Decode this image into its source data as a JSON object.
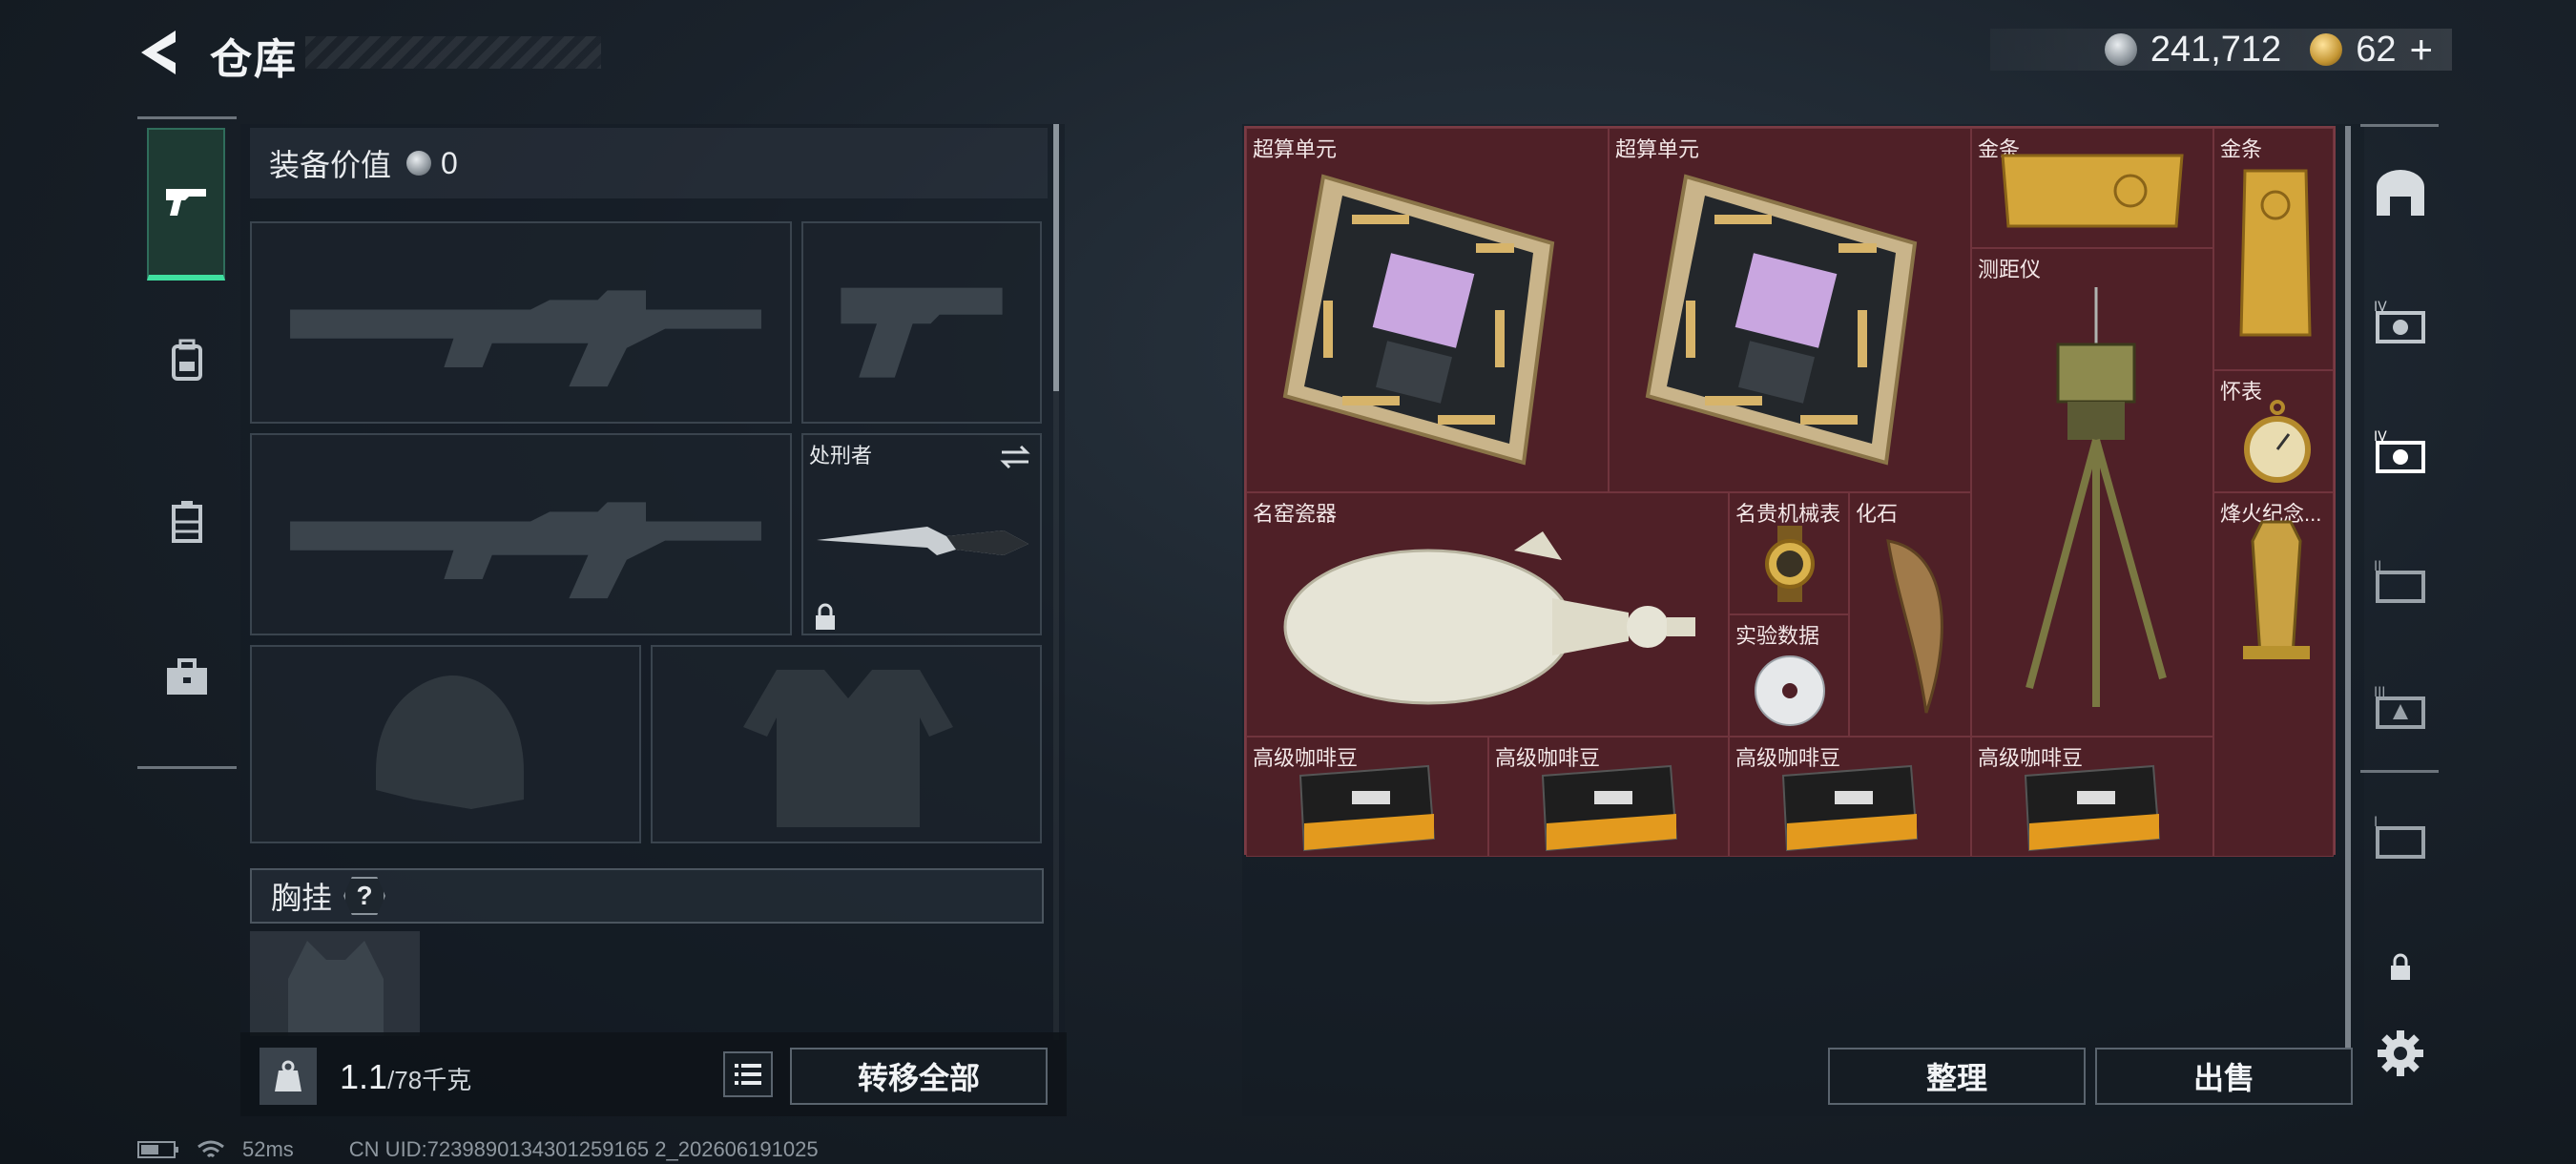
{
  "header": {
    "title": "仓库",
    "currency_silver": "241,712",
    "currency_gold": "62",
    "plus": "+"
  },
  "left_tabs": [
    {
      "name": "pistol",
      "active": true
    },
    {
      "name": "backpack"
    },
    {
      "name": "rig"
    },
    {
      "name": "case"
    }
  ],
  "equipment": {
    "value_label": "装备价值",
    "value": "0",
    "melee_label": "处刑者",
    "chest_rig_label": "胸挂",
    "chest_help": "?"
  },
  "bottom": {
    "weight_current": "1.1",
    "weight_max": "/78千克",
    "transfer_all": "转移全部",
    "sort": "整理",
    "sell": "出售"
  },
  "storage_items": [
    {
      "label": "超算单元",
      "icon": "supercomputer-board"
    },
    {
      "label": "超算单元",
      "icon": "supercomputer-board"
    },
    {
      "label": "金条",
      "icon": "gold-bar-horizontal"
    },
    {
      "label": "金条",
      "icon": "gold-bar-vertical"
    },
    {
      "label": "测距仪",
      "icon": "rangefinder-tripod"
    },
    {
      "label": "怀表",
      "icon": "pocket-watch"
    },
    {
      "label": "名窑瓷器",
      "icon": "porcelain-vase"
    },
    {
      "label": "名贵机械表",
      "icon": "mechanical-watch"
    },
    {
      "label": "化石",
      "icon": "fossil-claw"
    },
    {
      "label": "实验数据",
      "icon": "data-disc"
    },
    {
      "label": "烽火纪念...",
      "icon": "trophy"
    },
    {
      "label": "高级咖啡豆",
      "icon": "coffee-beans"
    },
    {
      "label": "高级咖啡豆",
      "icon": "coffee-beans"
    },
    {
      "label": "高级咖啡豆",
      "icon": "coffee-beans"
    },
    {
      "label": "高级咖啡豆",
      "icon": "coffee-beans"
    }
  ],
  "right_tabs": [
    "home-icon",
    "tier4-gear-icon",
    "tier4-gear-active-icon",
    "tier2-gear-icon",
    "tier3-gear-icon",
    "tier1-gear-icon",
    "lock-icon"
  ],
  "status": {
    "ping": "52ms",
    "uid": "CN UID:7239890134301259165 2_202606191025"
  },
  "colors": {
    "accent_green": "#3fe0a0",
    "storage_bg": "#4f2027"
  }
}
